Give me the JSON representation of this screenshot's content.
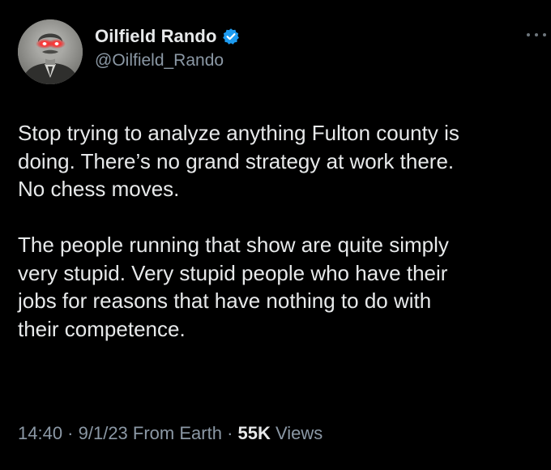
{
  "author": {
    "display_name": "Oilfield Rando",
    "handle": "@Oilfield_Rando",
    "verified": true,
    "avatar_icon": "portrait-laser-eyes-avatar"
  },
  "tweet": {
    "paragraphs": [
      [
        "Stop trying to analyze anything Fulton county is",
        "doing. There’s no grand strategy at work there.",
        "No chess moves."
      ],
      [
        "The people running that show are quite simply",
        "very stupid. Very stupid people who have their",
        "jobs for reasons that have nothing to do with",
        "their competence."
      ]
    ]
  },
  "meta": {
    "time": "14:40",
    "separator": " · ",
    "date": "9/1/23",
    "source": "From Earth",
    "views_count": "55K",
    "views_label": "Views"
  },
  "colors": {
    "background": "#000000",
    "primary_text": "#e7e9ea",
    "secondary_text": "#8b98a5",
    "verified_badge": "#1d9bf0",
    "laser_eyes": "#ff1a1a"
  }
}
